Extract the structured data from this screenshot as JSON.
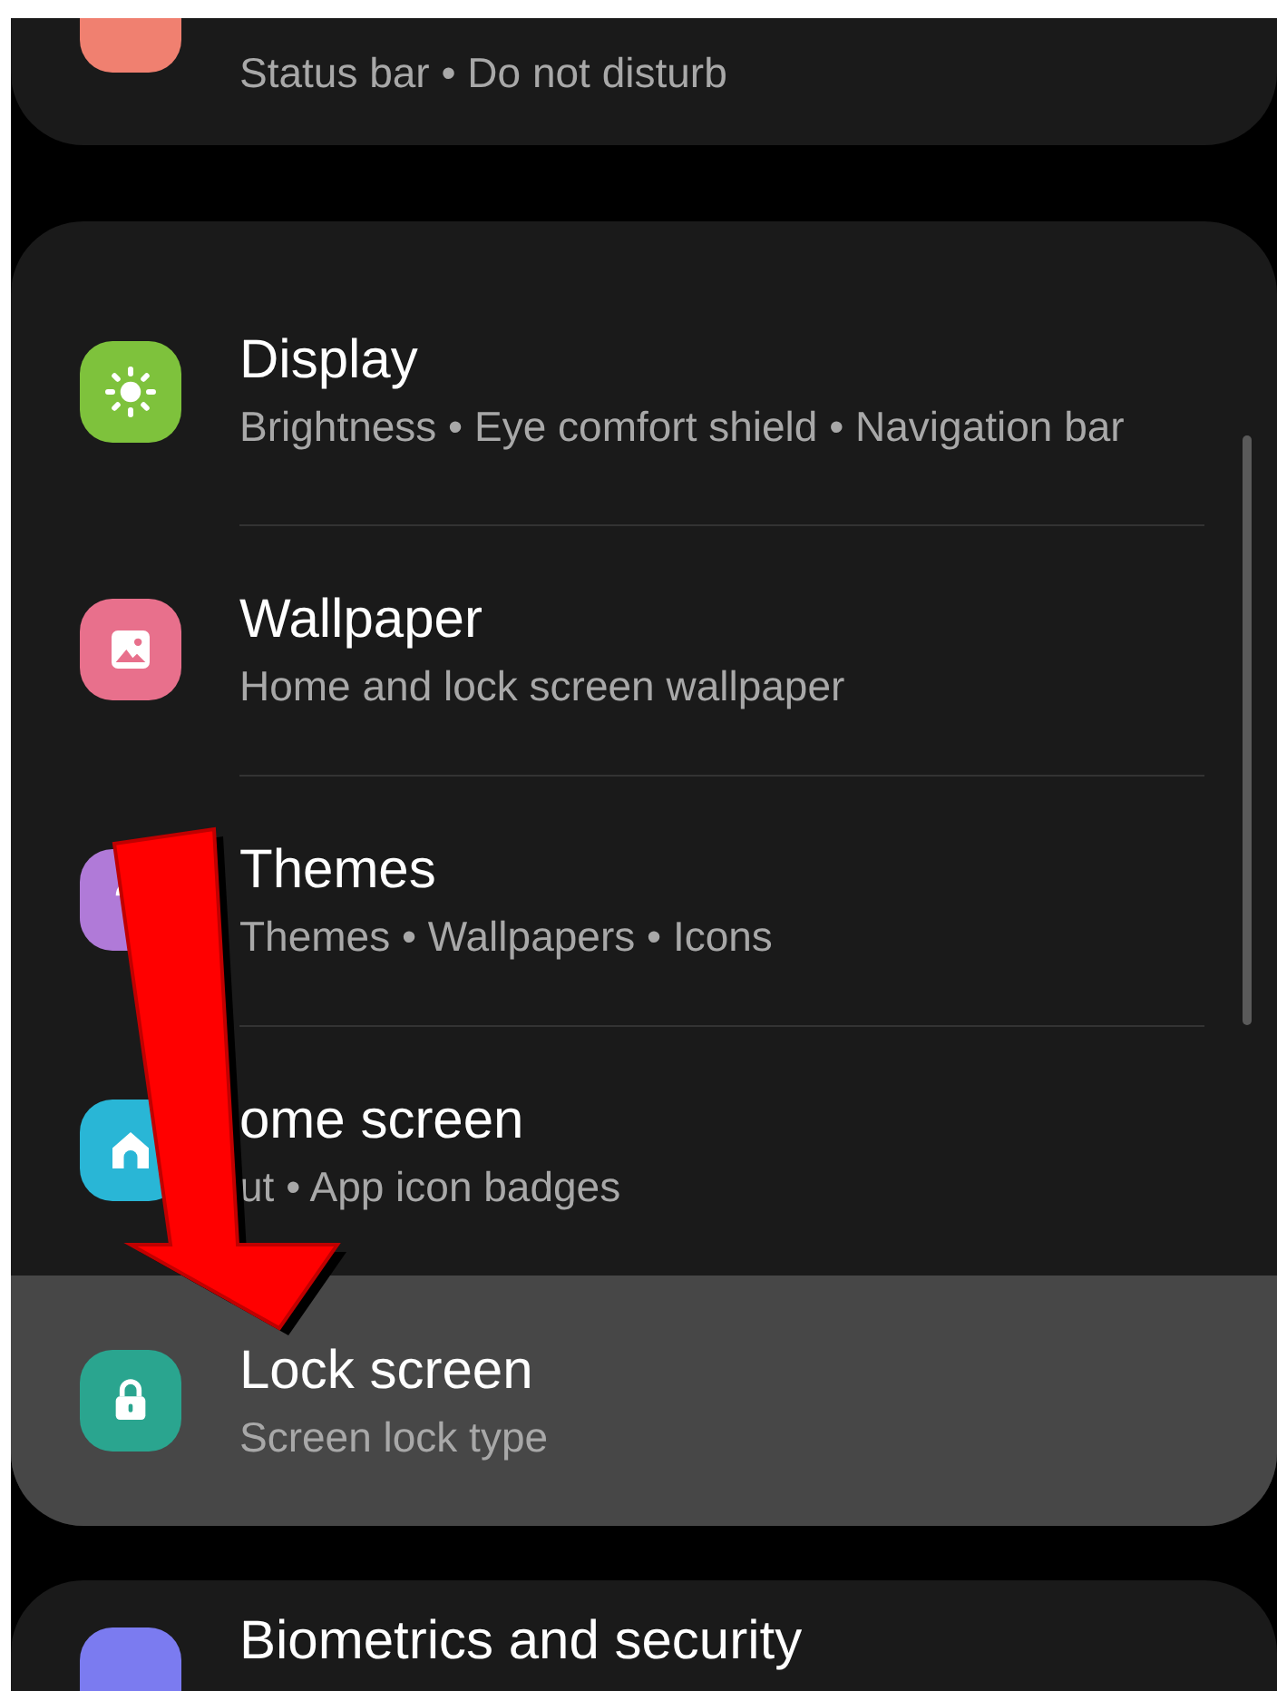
{
  "top_card": {
    "subtitle": "Status bar • Do not disturb",
    "color": "#f08070"
  },
  "settings": [
    {
      "title": "Display",
      "subtitle": "Brightness • Eye comfort shield • Navigation bar",
      "kind": "sun",
      "color": "#7ec23c",
      "selected": false
    },
    {
      "title": "Wallpaper",
      "subtitle": "Home and lock screen wallpaper",
      "kind": "image",
      "color": "#e8708c",
      "selected": false
    },
    {
      "title": "Themes",
      "subtitle": "Themes • Wallpapers • Icons",
      "kind": "brush",
      "color": "#b07ad8",
      "selected": false
    },
    {
      "title": "ome screen",
      "subtitle": "ut • App icon badges",
      "kind": "home",
      "color": "#29b6d6",
      "selected": false
    },
    {
      "title": "Lock screen",
      "subtitle": "Screen lock type",
      "kind": "lock",
      "color": "#2aa58f",
      "selected": true
    }
  ],
  "bottom_card": {
    "title": "Biometrics and security",
    "color": "#7b7bf0"
  }
}
